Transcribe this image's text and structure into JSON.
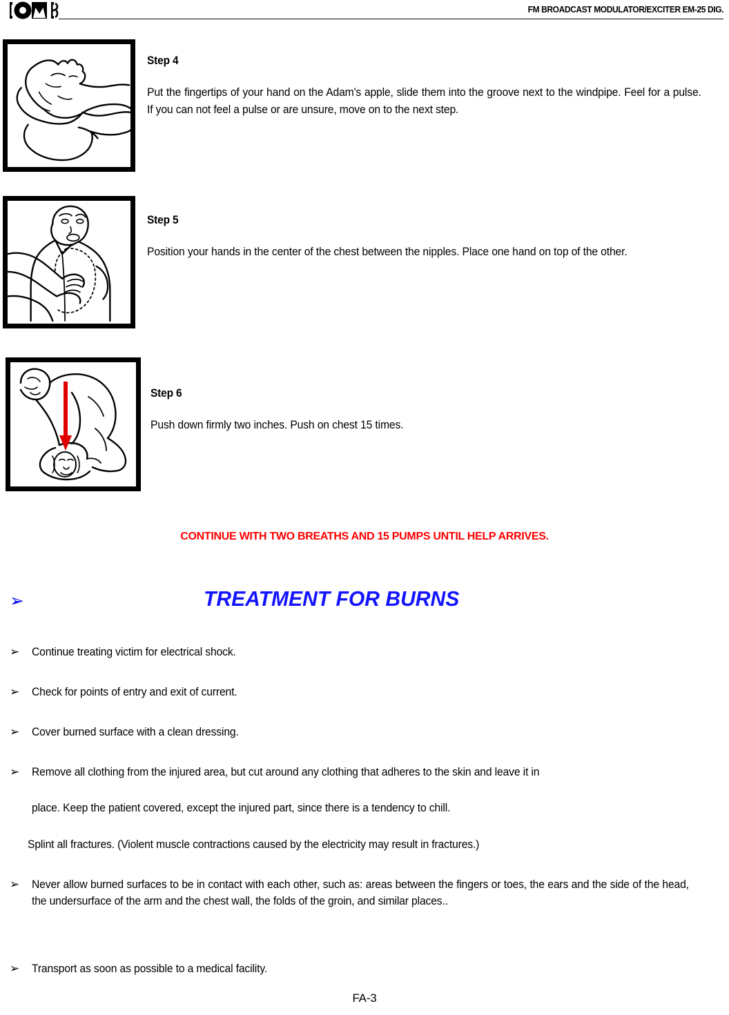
{
  "header": {
    "logo_text": "OMB",
    "title": "FM BROADCAST MODULATOR/EXCITER EM-25 DIG."
  },
  "steps": [
    {
      "title": "Step 4",
      "text": "Put the fingertips of your hand on the Adam's apple, slide them into the groove next to the windpipe. Feel for a pulse. If you can not feel a pulse or are unsure, move on to the next step.",
      "image_name": "check-pulse-illustration"
    },
    {
      "title": "Step 5",
      "text": "Position your hands in the center of the chest between the nipples. Place one hand on top of the other.",
      "image_name": "hand-position-chest-illustration"
    },
    {
      "title": "Step 6",
      "text": "Push down firmly two inches. Push on chest 15 times.",
      "image_name": "chest-compression-illustration"
    }
  ],
  "red_notice": "CONTINUE WITH TWO BREATHS AND 15 PUMPS UNTIL HELP ARRIVES.",
  "section": {
    "bullet_glyph": "➢",
    "heading": "TREATMENT FOR BURNS",
    "heading_color": "#1414ff",
    "notice_color": "#ff0000"
  },
  "bullets": [
    {
      "glyph": "➢",
      "text": "Continue treating victim for electrical shock."
    },
    {
      "glyph": "➢",
      "text": "Check for points of entry and exit of current."
    },
    {
      "glyph": "➢",
      "text": "Cover burned surface with a clean dressing."
    },
    {
      "glyph": "➢",
      "text": "Remove all clothing from the injured area, but cut around any clothing that adheres to the skin and leave it in"
    },
    {
      "glyph": "➢",
      "text": "Never allow burned surfaces to be in contact with each other, such as: areas between the fingers or toes, the ears and the side of the head, the undersurface of the arm and the chest wall, the folds of the groin, and similar places.."
    },
    {
      "glyph": "➢",
      "text": "Transport as soon as possible to a medical facility."
    }
  ],
  "continuation_lines": {
    "remove_clothing_cont": "place. Keep the patient covered, except the injured part, since there is a tendency to chill.",
    "splint_line": "Splint all fractures. (Violent muscle contractions caused by the electricity may result in fractures.)"
  },
  "footer": {
    "page_number": "FA-3"
  }
}
